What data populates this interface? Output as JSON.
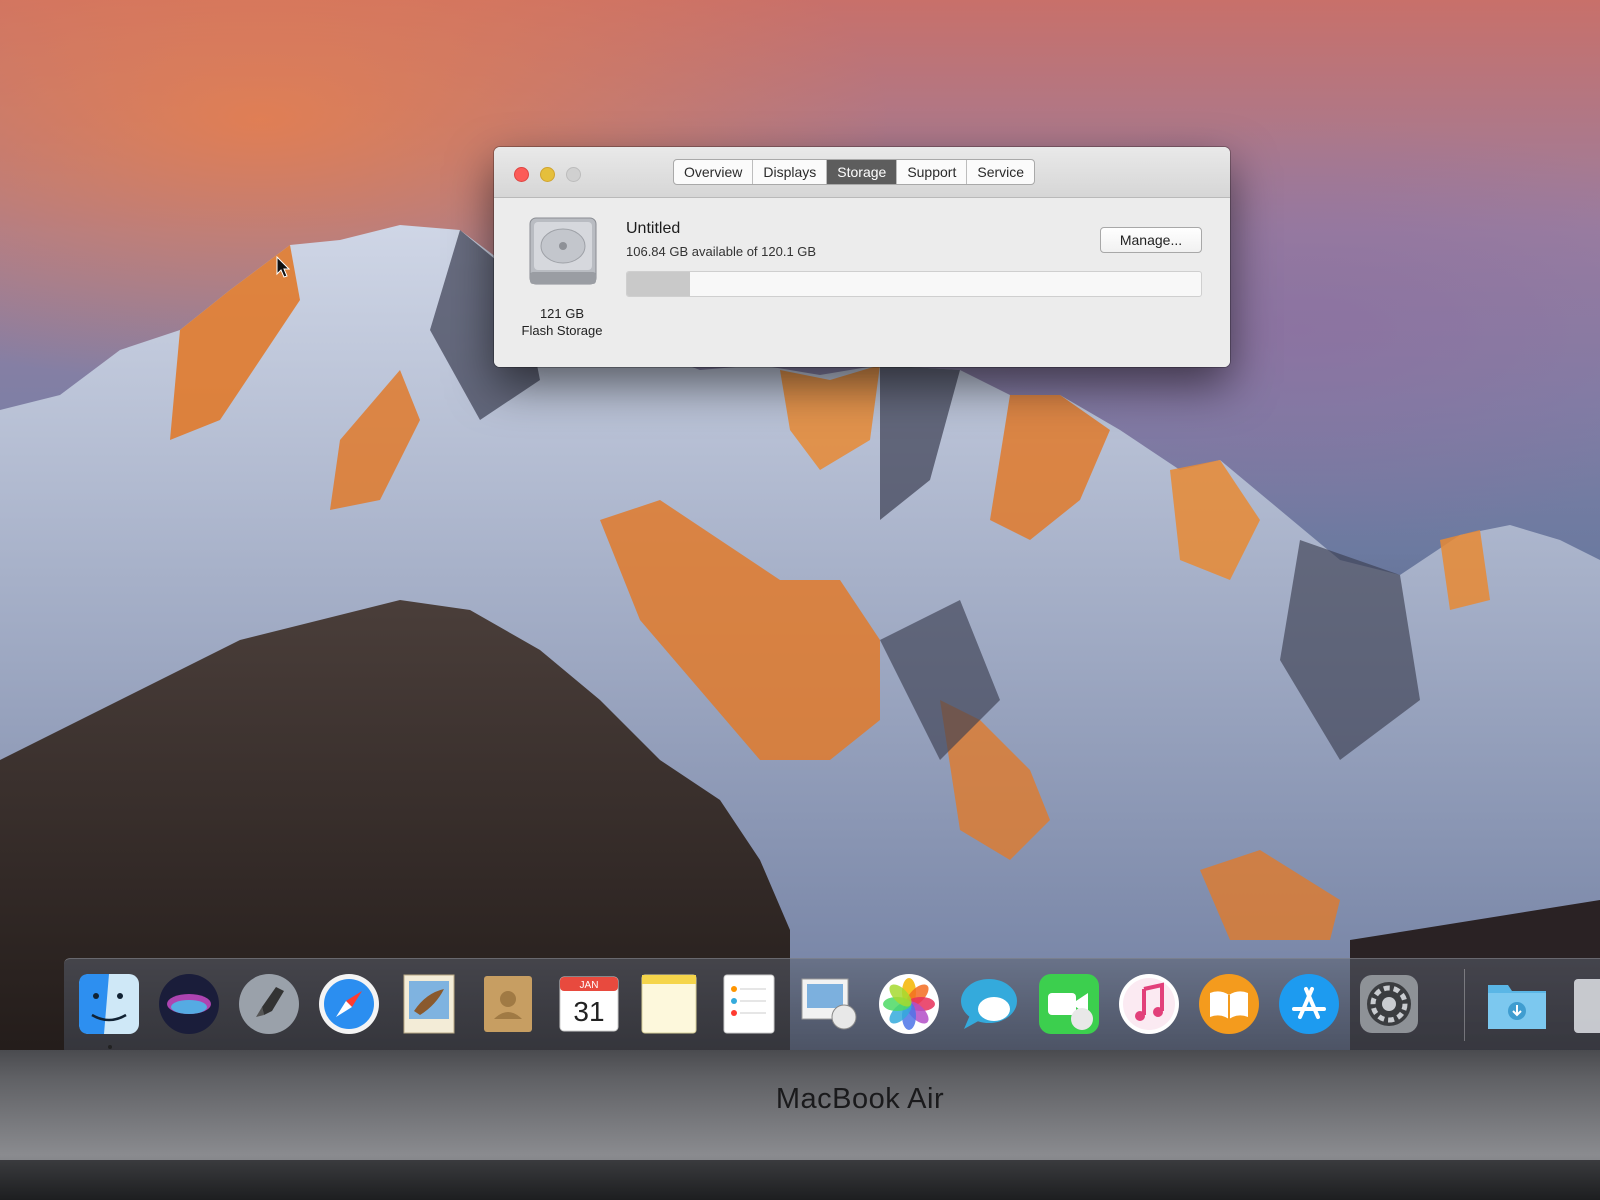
{
  "window": {
    "tabs": [
      {
        "label": "Overview",
        "active": false
      },
      {
        "label": "Displays",
        "active": false
      },
      {
        "label": "Storage",
        "active": true
      },
      {
        "label": "Support",
        "active": false
      },
      {
        "label": "Service",
        "active": false
      }
    ],
    "disk": {
      "capacity_label": "121 GB",
      "type_label": "Flash Storage",
      "volume_name": "Untitled",
      "availability": "106.84 GB available of 120.1 GB",
      "used_fraction": 0.11
    },
    "manage_button": "Manage..."
  },
  "dock": {
    "apps": [
      "finder-icon",
      "siri-icon",
      "launchpad-icon",
      "safari-icon",
      "mail-icon",
      "contacts-icon",
      "calendar-icon",
      "notes-icon",
      "reminders-icon",
      "keynote-icon",
      "photos-icon",
      "messages-icon",
      "facetime-icon",
      "itunes-icon",
      "ibooks-icon",
      "app-store-icon",
      "system-preferences-icon",
      "downloads-folder-icon"
    ],
    "calendar": {
      "month": "JAN",
      "day": "31"
    }
  },
  "hardware": {
    "brand": "MacBook Air"
  },
  "colors": {
    "close": "#fc5b57",
    "minimize": "#e5bf3c",
    "active_tab": "#5d5d5d"
  }
}
